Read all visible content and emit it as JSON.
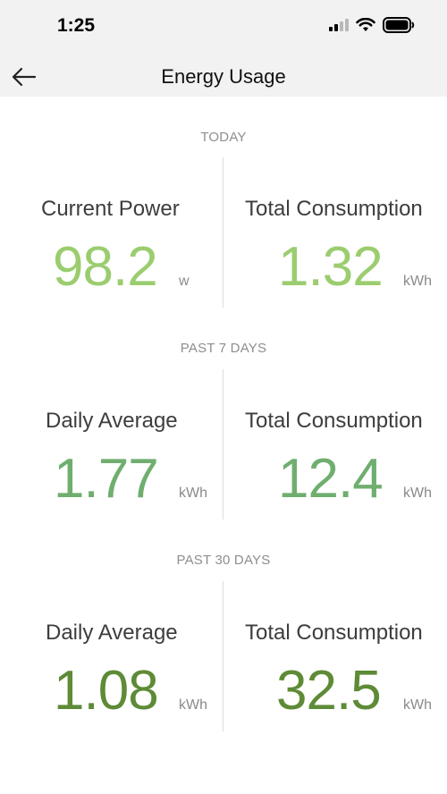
{
  "status_bar": {
    "time": "1:25"
  },
  "header": {
    "title": "Energy Usage",
    "back_icon": "arrow-left-icon"
  },
  "colors": {
    "today_value": "#9bcd6f",
    "past7_value": "#6fae6f",
    "past30_value": "#5e8b36"
  },
  "sections": [
    {
      "label": "TODAY",
      "left": {
        "label": "Current Power",
        "value": "98.2",
        "unit": "w"
      },
      "right": {
        "label": "Total Consumption",
        "value": "1.32",
        "unit": "kWh"
      }
    },
    {
      "label": "PAST 7 DAYS",
      "left": {
        "label": "Daily Average",
        "value": "1.77",
        "unit": "kWh"
      },
      "right": {
        "label": "Total Consumption",
        "value": "12.4",
        "unit": "kWh"
      }
    },
    {
      "label": "PAST 30 DAYS",
      "left": {
        "label": "Daily Average",
        "value": "1.08",
        "unit": "kWh"
      },
      "right": {
        "label": "Total Consumption",
        "value": "32.5",
        "unit": "kWh"
      }
    }
  ]
}
